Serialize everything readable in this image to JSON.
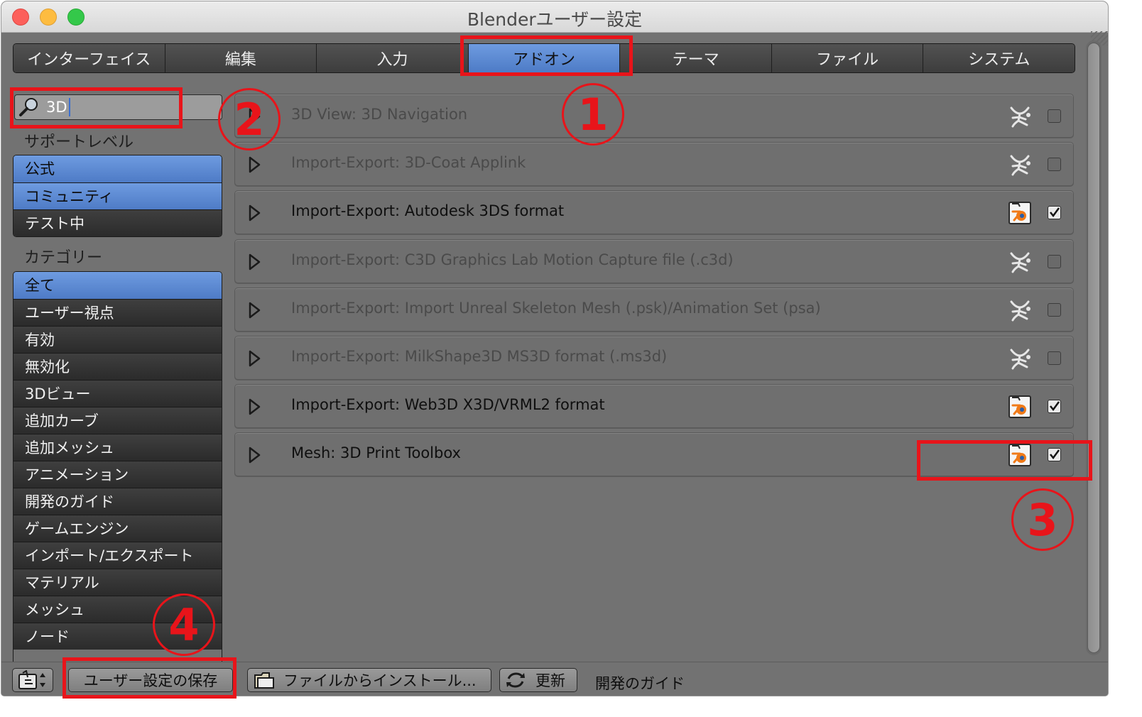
{
  "window": {
    "title": "Blenderユーザー設定"
  },
  "tabs": [
    {
      "label": "インターフェイス",
      "active": false
    },
    {
      "label": "編集",
      "active": false
    },
    {
      "label": "入力",
      "active": false
    },
    {
      "label": "アドオン",
      "active": true
    },
    {
      "label": "テーマ",
      "active": false
    },
    {
      "label": "ファイル",
      "active": false
    },
    {
      "label": "システム",
      "active": false
    }
  ],
  "search": {
    "value": "3D"
  },
  "support_level": {
    "heading": "サポートレベル",
    "items": [
      {
        "label": "公式",
        "selected": true
      },
      {
        "label": "コミュニティ",
        "selected": true
      },
      {
        "label": "テスト中",
        "selected": false
      }
    ]
  },
  "categories": {
    "heading": "カテゴリー",
    "items": [
      {
        "label": "全て",
        "selected": true
      },
      {
        "label": "ユーザー視点",
        "selected": false
      },
      {
        "label": "有効",
        "selected": false
      },
      {
        "label": "無効化",
        "selected": false
      },
      {
        "label": "3Dビュー",
        "selected": false
      },
      {
        "label": "追加カーブ",
        "selected": false
      },
      {
        "label": "追加メッシュ",
        "selected": false
      },
      {
        "label": "アニメーション",
        "selected": false
      },
      {
        "label": "開発のガイド",
        "selected": false
      },
      {
        "label": "ゲームエンジン",
        "selected": false
      },
      {
        "label": "インポート/エクスポート",
        "selected": false
      },
      {
        "label": "マテリアル",
        "selected": false
      },
      {
        "label": "メッシュ",
        "selected": false
      },
      {
        "label": "ノード",
        "selected": false
      }
    ]
  },
  "addons": [
    {
      "name": "3D View: 3D Navigation",
      "enabled": false,
      "icon": "community-icon"
    },
    {
      "name": "Import-Export: 3D-Coat Applink",
      "enabled": false,
      "icon": "community-icon"
    },
    {
      "name": "Import-Export: Autodesk 3DS format",
      "enabled": true,
      "icon": "blender-official-icon"
    },
    {
      "name": "Import-Export: C3D Graphics Lab Motion Capture file (.c3d)",
      "enabled": false,
      "icon": "community-icon"
    },
    {
      "name": "Import-Export: Import Unreal Skeleton Mesh (.psk)/Animation Set (psa)",
      "enabled": false,
      "icon": "community-icon"
    },
    {
      "name": "Import-Export: MilkShape3D MS3D format (.ms3d)",
      "enabled": false,
      "icon": "community-icon"
    },
    {
      "name": "Import-Export: Web3D X3D/VRML2 format",
      "enabled": true,
      "icon": "blender-official-icon"
    },
    {
      "name": "Mesh: 3D Print Toolbox",
      "enabled": true,
      "icon": "blender-official-icon"
    }
  ],
  "bottom": {
    "save_label": "ユーザー設定の保存",
    "install_label": "ファイルからインストール...",
    "refresh_label": "更新",
    "guide_label": "開発のガイド"
  },
  "annotations": [
    "1",
    "2",
    "3",
    "4"
  ],
  "colors": {
    "panel_bg": "#727272",
    "active_blue": "#5a87d2",
    "annotation_red": "#e8141a"
  }
}
